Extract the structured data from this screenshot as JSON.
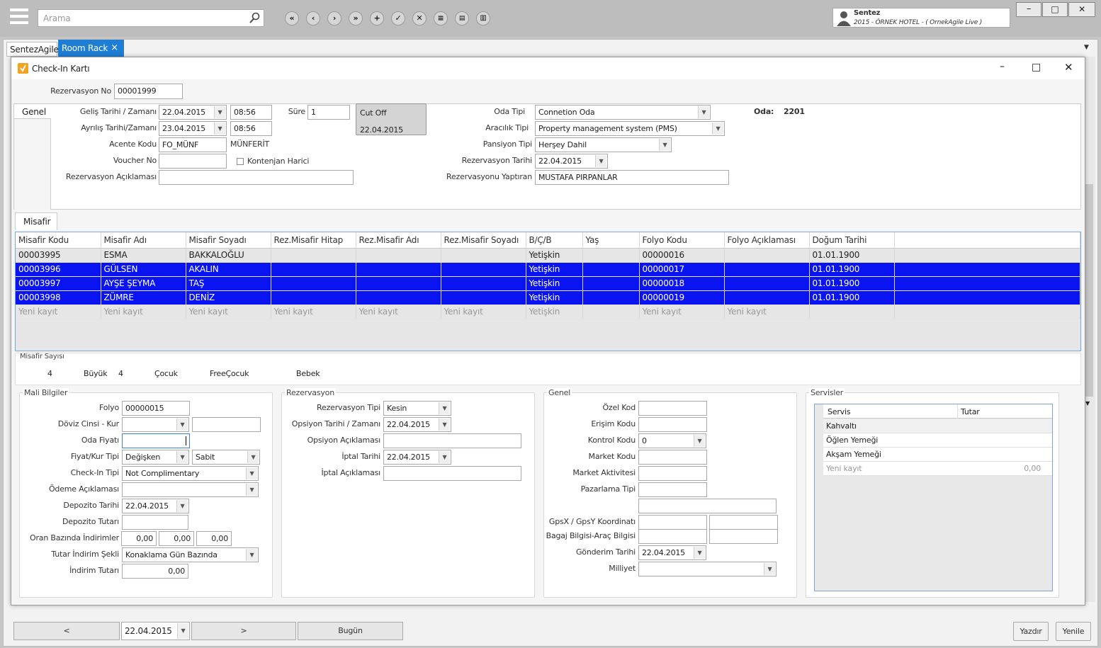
{
  "topbar": {
    "search_placeholder": "Arama",
    "user_name": "Sentez",
    "user_info": "2015 - ÖRNEK HOTEL - ( OrnekAgile Live )",
    "toolbar_icons": [
      "first",
      "prev",
      "next",
      "last",
      "add",
      "save",
      "delete",
      "list",
      "keyboard",
      "trash"
    ]
  },
  "tabs": [
    {
      "label": "SentezAgile"
    },
    {
      "label": "Room Rack",
      "close": "×"
    }
  ],
  "dialog": {
    "title": "Check-In Kartı",
    "rez_label": "Rezervasyon No",
    "rez_value": "00001999"
  },
  "genel": {
    "tab": "Genel",
    "gelis_label": "Geliş Tarihi / Zamanı",
    "gelis_date": "22.04.2015",
    "gelis_time": "08:56",
    "ayrilis_label": "Ayrılış Tarihi/Zamanı",
    "ayrilis_date": "23.04.2015",
    "ayrilis_time": "08:56",
    "sure_label": "Süre",
    "sure_value": "1",
    "cutoff_label": "Cut Off",
    "cutoff_date": "22.04.2015",
    "acente_label": "Acente Kodu",
    "acente_value": "FO_MÜNF",
    "acente_name": "MÜNFERİT",
    "voucher_label": "Voucher No",
    "voucher_value": "",
    "kontenjan_label": "Kontenjan Harici",
    "aciklama_label": "Rezervasyon Açıklaması",
    "aciklama_value": "",
    "oda_tipi_label": "Oda Tipi",
    "oda_tipi_value": "Connetion Oda",
    "oda_label": "Oda:",
    "oda_value": "2201",
    "aracilik_label": "Aracılık Tipi",
    "aracilik_value": "Property management system (PMS)",
    "pansiyon_label": "Pansiyon Tipi",
    "pansiyon_value": "Herşey Dahil",
    "rez_tarihi_label": "Rezervasyon Tarihi",
    "rez_tarihi_value": "22.04.2015",
    "yaptiran_label": "Rezervasyonu Yaptıran",
    "yaptiran_value": "MUSTAFA PIRPANLAR"
  },
  "misafir": {
    "tab": "Misafir",
    "columns": [
      "Misafir Kodu",
      "Misafir Adı",
      "Misafir Soyadı",
      "Rez.Misafir Hitap",
      "Rez.Misafir Adı",
      "Rez.Misafir Soyadı",
      "B/Ç/B",
      "Yaş",
      "Folyo Kodu",
      "Folyo Açıklaması",
      "Doğum Tarihi",
      ""
    ],
    "rows": [
      {
        "cells": [
          "00003995",
          "ESMA",
          "BAKKALOĞLU",
          "",
          "",
          "",
          "Yetişkin",
          "",
          "00000016",
          "",
          "01.01.1900",
          ""
        ],
        "selected": false
      },
      {
        "cells": [
          "00003996",
          "GÜLSEN",
          "AKALIN",
          "",
          "",
          "",
          "Yetişkin",
          "",
          "00000017",
          "",
          "01.01.1900",
          ""
        ],
        "selected": true
      },
      {
        "cells": [
          "00003997",
          "AYŞE ŞEYMA",
          "TAŞ",
          "",
          "",
          "",
          "Yetişkin",
          "",
          "00000018",
          "",
          "01.01.1900",
          ""
        ],
        "selected": true
      },
      {
        "cells": [
          "00003998",
          "ZÜMRE",
          "DENİZ",
          "",
          "",
          "",
          "Yetişkin",
          "",
          "00000019",
          "",
          "01.01.1900",
          ""
        ],
        "selected": true
      }
    ],
    "new_row": [
      "Yeni kayıt",
      "Yeni kayıt",
      "Yeni kayıt",
      "Yeni kayıt",
      "Yeni kayıt",
      "Yeni kayıt",
      "Yetişkin",
      "",
      "Yeni kayıt",
      "Yeni kayıt",
      "",
      ""
    ]
  },
  "sayisi": {
    "title": "Misafir Sayısı",
    "total": "4",
    "buyuk_label": "Büyük",
    "buyuk": "4",
    "cocuk_label": "Çocuk",
    "free_label": "FreeÇocuk",
    "bebek_label": "Bebek"
  },
  "mali": {
    "title": "Mali Bilgiler",
    "folyo_label": "Folyo",
    "folyo": "00000015",
    "doviz_label": "Döviz Cinsi - Kur",
    "oda_fiyati_label": "Oda Fiyatı",
    "fiyat_kur_label": "Fiyat/Kur Tipi",
    "fiyat_tipi": "Değişken",
    "kur_tipi": "Sabit",
    "checkin_tipi_label": "Check-In Tipi",
    "checkin_tipi": "Not Complimentary",
    "odeme_label": "Ödeme Açıklaması",
    "depozito_tarihi_label": "Depozito Tarihi",
    "depozito_tarihi": "22.04.2015",
    "depozito_tutari_label": "Depozito Tutarı",
    "oran_label": "Oran Bazında İndirimler",
    "oran1": "0,00",
    "oran2": "0,00",
    "oran3": "0,00",
    "tutar_indirim_label": "Tutar İndirim Şekli",
    "tutar_indirim": "Konaklama Gün Bazında",
    "indirim_tutari_label": "İndirim Tutarı",
    "indirim_tutari": "0,00"
  },
  "rezervasyon": {
    "title": "Rezervasyon",
    "tipi_label": "Rezervasyon Tipi",
    "tipi": "Kesin",
    "opsiyon_tarihi_label": "Opsiyon Tarihi /  Zamanı",
    "opsiyon_tarihi": "22.04.2015",
    "opsiyon_aciklama_label": "Opsiyon Açıklaması",
    "iptal_tarihi_label": "İptal Tarihi",
    "iptal_tarihi": "22.04.2015",
    "iptal_aciklama_label": "İptal Açıklaması"
  },
  "genel2": {
    "title": "Genel",
    "ozel_kod_label": "Özel Kod",
    "erisim_label": "Erişim Kodu",
    "kontrol_label": "Kontrol Kodu",
    "kontrol": "0",
    "market_kodu_label": "Market Kodu",
    "market_akt_label": "Market Aktivitesi",
    "pazarlama_label": "Pazarlama Tipi",
    "gps_label": "GpsX / GpsY Koordinatı",
    "bagaj_label": "Bagaj Bilgisi-Araç Bilgisi",
    "gonderim_label": "Gönderim Tarihi",
    "gonderim": "22.04.2015",
    "milliyet_label": "Milliyet"
  },
  "servisler": {
    "title": "Servisler",
    "col_servis": "Servis",
    "col_tutar": "Tutar",
    "rows": [
      "Kahvaltı",
      "Öğlen Yemeği",
      "Akşam Yemeği"
    ],
    "new_row": "Yeni kayıt",
    "new_tutar": "0,00"
  },
  "bottom": {
    "prev": "<",
    "date": "22.04.2015",
    "next": ">",
    "today": "Bugün",
    "print": "Yazdır",
    "refresh": "Yenile"
  }
}
